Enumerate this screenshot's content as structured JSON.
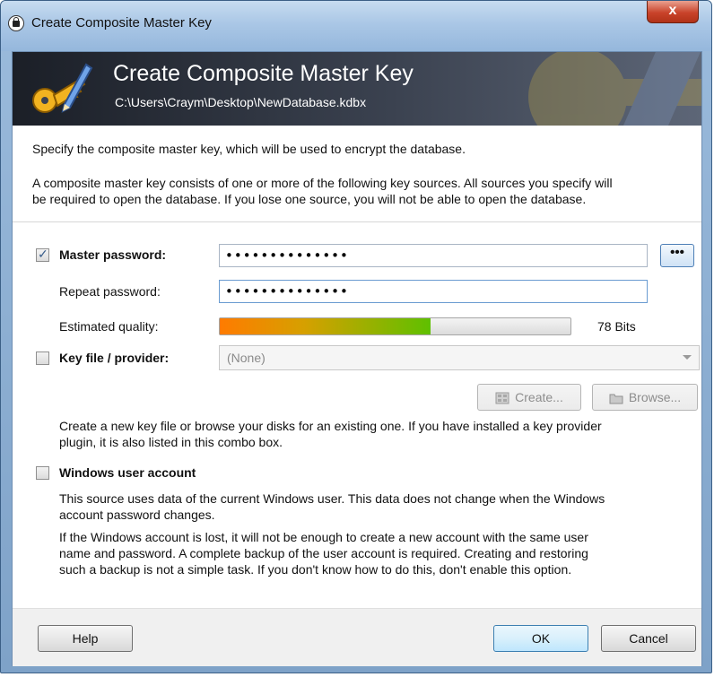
{
  "window": {
    "title": "Create Composite Master Key",
    "close_label": "x"
  },
  "banner": {
    "title": "Create Composite Master Key",
    "path": "C:\\Users\\Craym\\Desktop\\NewDatabase.kdbx"
  },
  "intro": {
    "line1": "Specify the composite master key, which will be used to encrypt the database.",
    "line2a": "A composite master key consists of one or more of the following key sources. All sources you specify will",
    "line2b": "be required to open the database.  If you lose one source, you will not be able to open the database."
  },
  "master_password": {
    "checked": true,
    "label": "Master password:",
    "value": "••••••••••••••",
    "toggle_label": "•••",
    "repeat_label": "Repeat password:",
    "repeat_value": "••••••••••••••",
    "quality_label": "Estimated quality:",
    "quality_fraction": 0.6,
    "quality_text": "78 Bits"
  },
  "key_file": {
    "checked": false,
    "label": "Key file / provider:",
    "selected": "(None)",
    "create_label": "Create...",
    "browse_label": "Browse...",
    "hint_a": "Create a new key file or browse your disks for an existing one. If you have installed a key provider",
    "hint_b": "plugin, it is also listed in this combo box."
  },
  "windows_account": {
    "checked": false,
    "label": "Windows user account",
    "desc_a": "This source uses data of the current Windows user. This data does not change when the Windows",
    "desc_b": "account password changes.",
    "warn_a": "If the Windows account is lost, it will not be enough to create a new account with the same user",
    "warn_b": "name and password. A complete backup of the user account is required. Creating and restoring",
    "warn_c": "such a backup is not a simple task. If you don't know how to do this, don't enable this option."
  },
  "footer": {
    "help_label": "Help",
    "ok_label": "OK",
    "cancel_label": "Cancel"
  }
}
